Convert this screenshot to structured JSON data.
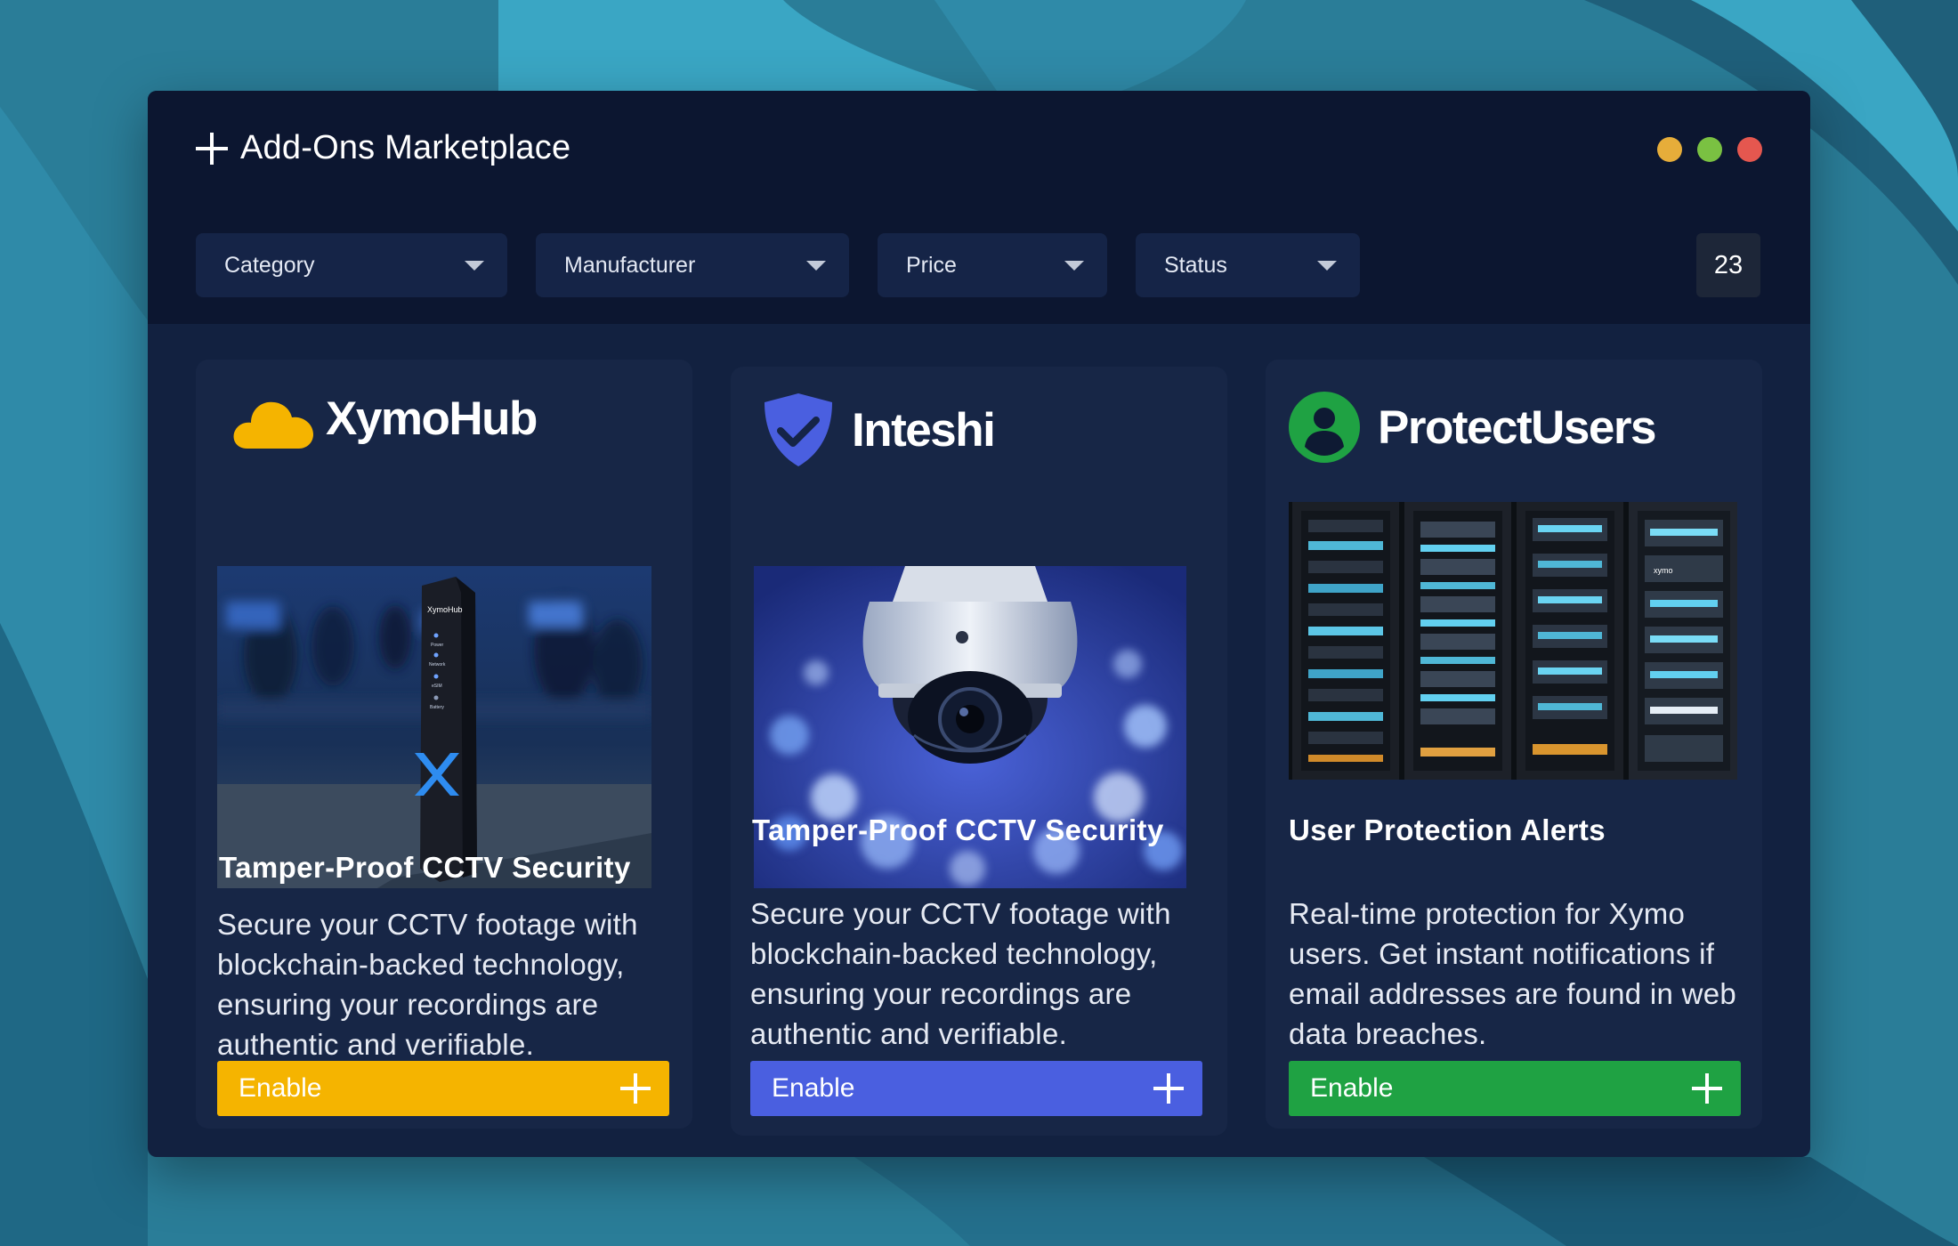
{
  "window": {
    "title": "Add-Ons Marketplace",
    "traffic_lights": [
      "#e6ad3a",
      "#7ac142",
      "#e5574f"
    ]
  },
  "filters": [
    {
      "label": "Category"
    },
    {
      "label": "Manufacturer"
    },
    {
      "label": "Price"
    },
    {
      "label": "Status"
    }
  ],
  "result_count": "23",
  "cards": [
    {
      "brand": "XymoHub",
      "brand_icon": "cloud-icon",
      "title": "Tamper-Proof CCTV Security",
      "description": "Secure your CCTV footage with blockchain-backed technology, ensuring your recordings are authentic and verifiable.",
      "button_label": "Enable",
      "accent": "#f5b400",
      "image_text": {
        "device_logo": "XymoHub",
        "leds": [
          "Power",
          "Network",
          "eSIM",
          "Battery"
        ]
      }
    },
    {
      "brand": "Inteshi",
      "brand_icon": "shield-check-icon",
      "title": "Tamper-Proof CCTV Security",
      "description": "Secure your CCTV footage with blockchain-backed technology, ensuring your recordings are authentic and verifiable.",
      "button_label": "Enable",
      "accent": "#4a5fe0"
    },
    {
      "brand": "ProtectUsers",
      "brand_icon": "user-circle-icon",
      "title": "User Protection Alerts",
      "description": "Real-time protection for Xymo users. Get instant notifications if email addresses are found in web data breaches.",
      "button_label": "Enable",
      "accent": "#1fa243",
      "image_text": {
        "rack_logo": "xymo"
      }
    }
  ]
}
